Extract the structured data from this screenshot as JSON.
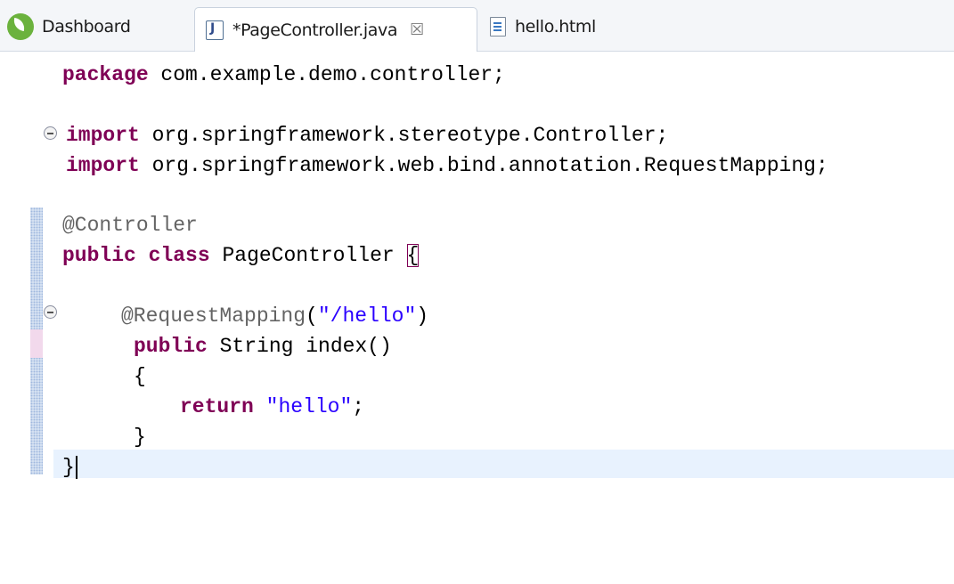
{
  "tabs": [
    {
      "label": "Dashboard",
      "icon": "spring-leaf-icon",
      "active": false
    },
    {
      "label": "*PageController.java",
      "icon": "java-file-icon",
      "active": true,
      "close_glyph": "☒"
    },
    {
      "label": "hello.html",
      "icon": "html-file-icon",
      "active": false
    }
  ],
  "code": {
    "l1": {
      "kw": "package",
      "rest": " com.example.demo.controller;"
    },
    "l2": {
      "kw": "import",
      "rest": " org.springframework.stereotype.Controller;"
    },
    "l3": {
      "kw": "import",
      "rest": " org.springframework.web.bind.annotation.RequestMapping;"
    },
    "l4": {
      "ann": "@Controller"
    },
    "l5": {
      "kw1": "public",
      "kw2": "class",
      "name": " PageController ",
      "brace": "{"
    },
    "l6": {
      "ann": "@RequestMapping",
      "open": "(",
      "str": "\"/hello\"",
      "close": ")"
    },
    "l7": {
      "kw": "public",
      "rest": " String index()"
    },
    "l8": {
      "text": "{"
    },
    "l9": {
      "kw": "return",
      "str": "\"hello\"",
      "semi": ";"
    },
    "l10": {
      "text": "}"
    },
    "l11": {
      "text": "}"
    }
  },
  "colors": {
    "keyword": "#7f0055",
    "annotation": "#646464",
    "string": "#2a00ff",
    "current_line": "#e8f2fe"
  }
}
